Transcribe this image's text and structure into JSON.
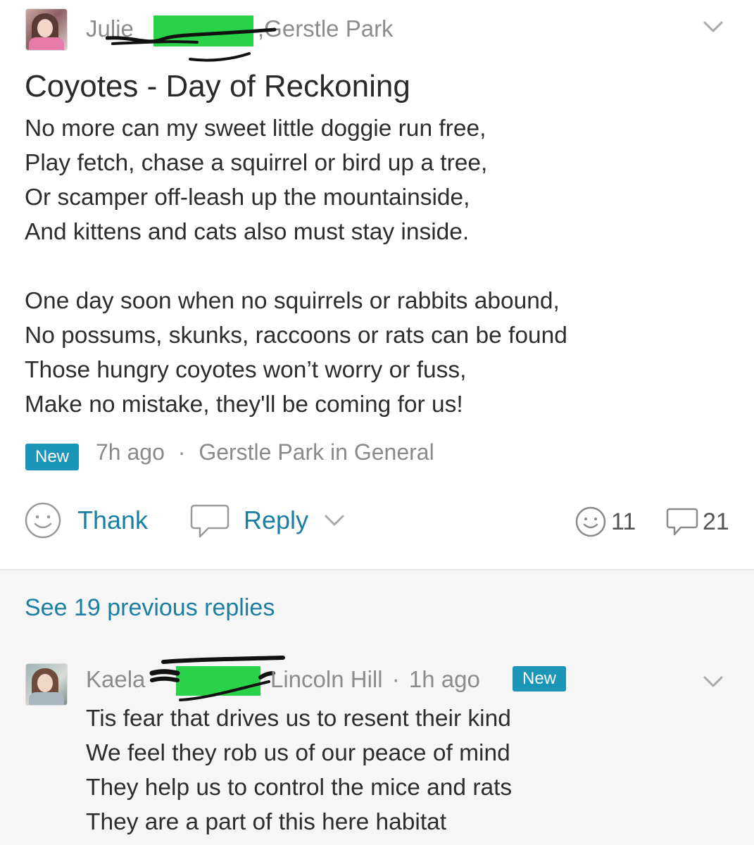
{
  "post": {
    "author_first": "Julie",
    "author_sep": ",",
    "neighborhood": "Gerstle Park",
    "title": "Coyotes - Day of Reckoning",
    "lines": [
      "No more can my sweet little doggie run free,",
      "Play fetch, chase a squirrel or bird up a tree,",
      "Or scamper off-leash up the mountainside,",
      "And kittens and cats also must stay inside.",
      "",
      "One day soon when no squirrels or rabbits abound,",
      "No possums, skunks, raccoons or rats can be found",
      "Those hungry coyotes won’t worry or fuss,",
      "Make no mistake, they'll be coming for us!"
    ],
    "badge": "New",
    "time": "7h ago",
    "dot": "·",
    "location": "Gerstle Park in General",
    "thank_label": "Thank",
    "reply_label": "Reply",
    "thanks_count": "11",
    "replies_count": "21"
  },
  "see_previous": "See 19 previous replies",
  "reply": {
    "author_first": "Kaela",
    "neighborhood": "Lincoln Hill",
    "dot": "·",
    "time": "1h ago",
    "badge": "New",
    "lines": [
      "Tis fear that drives us to resent their kind",
      "We feel they rob us of our peace of mind",
      "They help us to control the mice and rats",
      "They are a part of this here habitat"
    ]
  },
  "colors": {
    "accent": "#1b7fa3",
    "badge": "#1b96b8",
    "redaction": "#2ad24a",
    "reply_background": "#f6f6f6"
  },
  "icons": [
    "smiley-icon",
    "speech-bubble-icon",
    "chevron-down-icon"
  ]
}
